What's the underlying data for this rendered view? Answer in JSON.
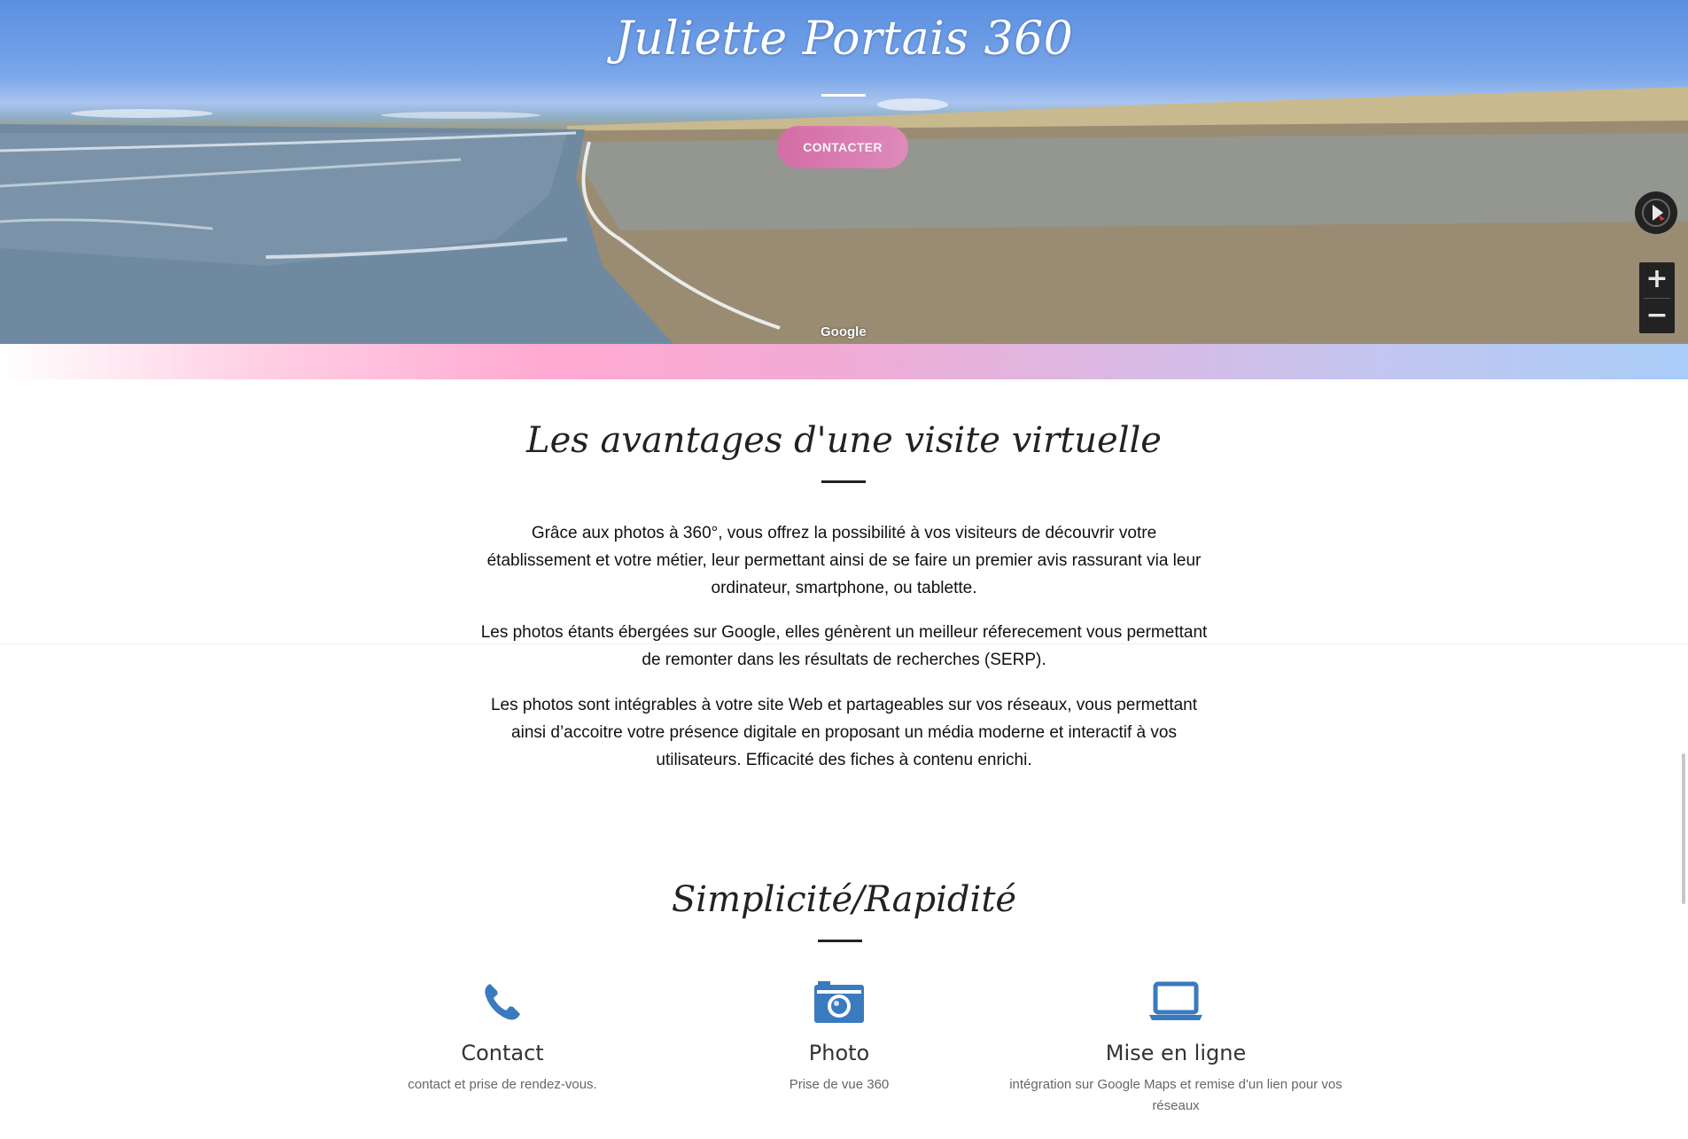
{
  "hero": {
    "title": "Juliette Portais 360",
    "contact_label": "CONTACTER",
    "map_attribution": "Google",
    "zoom_in": "+",
    "zoom_out": "−"
  },
  "advantages": {
    "title": "Les avantages d'une visite virtuelle",
    "paragraphs": [
      "Grâce aux photos à 360°, vous offrez la possibilité à vos visiteurs de découvrir votre établissement et votre métier, leur permettant ainsi de se faire un premier avis rassurant via leur ordinateur, smartphone, ou tablette.",
      "Les photos étants ébergées sur Google, elles génèrent un meilleur réferecement vous permettant de remonter dans les résultats de recherches (SERP).",
      "Les photos sont intégrables à votre site Web et partageables sur vos réseaux, vous permettant ainsi d’accoitre votre présence digitale en proposant un média moderne et interactif à vos utilisateurs. Efficacité des fiches à contenu enrichi."
    ]
  },
  "simplicity": {
    "title": "Simplicité/Rapidité",
    "features": [
      {
        "icon": "phone-icon",
        "title": "Contact",
        "desc": "contact et prise de rendez-vous."
      },
      {
        "icon": "camera-icon",
        "title": "Photo",
        "desc": "Prise de vue 360"
      },
      {
        "icon": "laptop-icon",
        "title": "Mise en ligne",
        "desc": "intégration sur Google Maps et remise d'un lien pour vos réseaux"
      }
    ]
  },
  "colors": {
    "accent_blue": "#3a7abf",
    "button_pink": "#d96aa8"
  }
}
